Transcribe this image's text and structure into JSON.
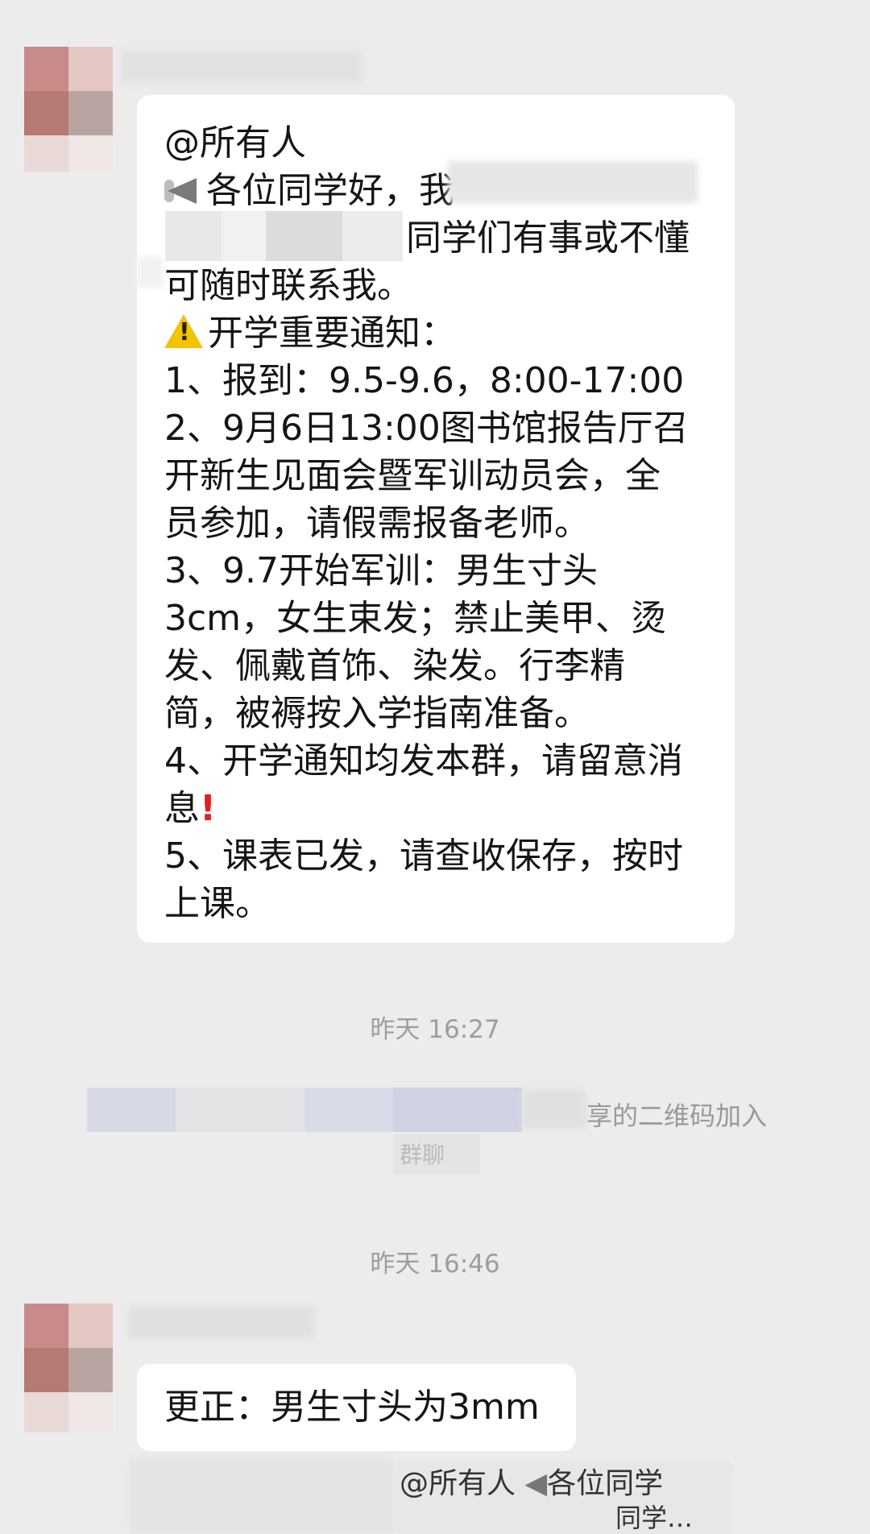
{
  "messages": [
    {
      "id": "notice",
      "lines": [
        "@所有人",
        "各位同学好，我",
        "同学们有事或不懂",
        "可随时联系我。",
        "开学重要通知：",
        "1、报到：9.5-9.6，8:00-17:00",
        "2、9月6日13:00图书馆报告厅召",
        "开新生见面会暨军训动员会，全",
        "员参加，请假需报备老师。",
        "3、9.7开始军训：男生寸头",
        "3cm，女生束发；禁止美甲、烫",
        "发、佩戴首饰、染发。行李精",
        "简，被褥按入学指南准备。",
        "4、开学通知均发本群，请留意消",
        "息",
        "5、课表已发，请查收保存，按时",
        "上课。"
      ]
    },
    {
      "id": "correction",
      "lines": [
        "更正：男生寸头为3mm"
      ]
    },
    {
      "id": "partial",
      "lines": [
        "@所有人",
        "各位同学",
        "同学…"
      ]
    }
  ],
  "timestamps": [
    "昨天 16:27",
    "昨天 16:46"
  ],
  "system": {
    "join_tail": "享的二维码加入",
    "join_tail2": "群聊"
  },
  "icons": {
    "megaphone": "megaphone-icon",
    "warning": "warning-icon",
    "exclamation": "red-exclamation-icon"
  },
  "colors": {
    "background": "#ececec",
    "bubble": "#ffffff",
    "text": "#151515",
    "timestamp": "#9e9e9e",
    "warning": "#f5c400",
    "exclamation": "#e02020"
  }
}
